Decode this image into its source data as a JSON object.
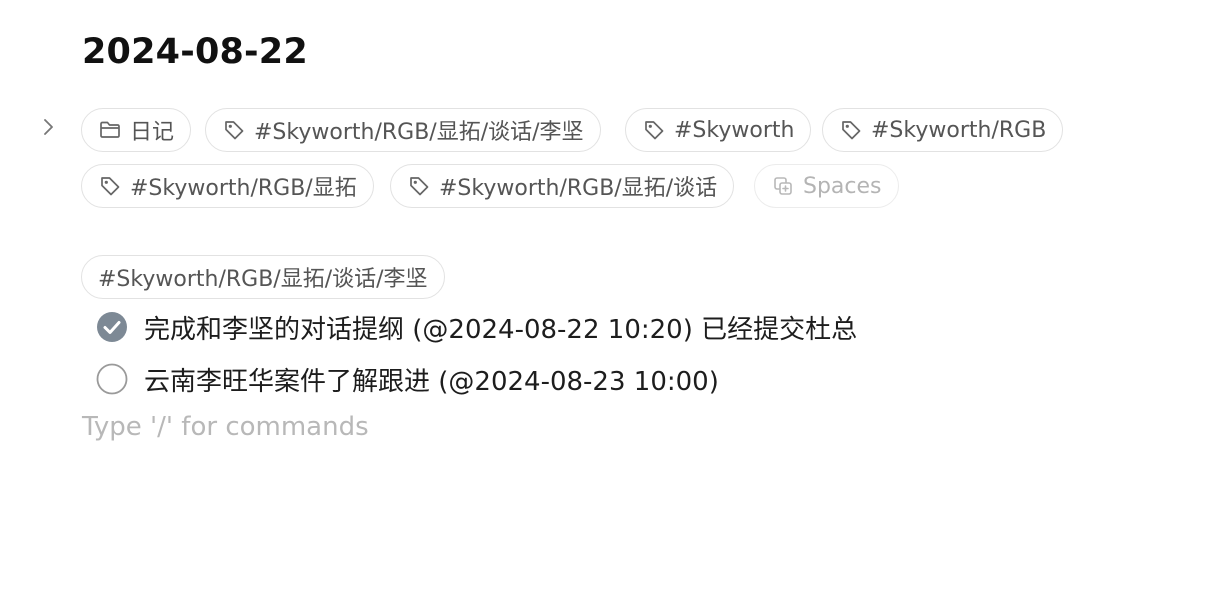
{
  "note": {
    "title": "2024-08-22"
  },
  "chips": [
    {
      "icon": "folder-icon",
      "label": "日记"
    },
    {
      "icon": "tag-icon",
      "label": "#Skyworth/RGB/显拓/谈话/李坚"
    },
    {
      "icon": "tag-icon",
      "label": "#Skyworth"
    },
    {
      "icon": "tag-icon",
      "label": "#Skyworth/RGB"
    },
    {
      "icon": "tag-icon",
      "label": "#Skyworth/RGB/显拓"
    },
    {
      "icon": "tag-icon",
      "label": "#Skyworth/RGB/显拓/谈话"
    },
    {
      "icon": "spaces-icon",
      "label": "Spaces"
    }
  ],
  "body": {
    "tag": "#Skyworth/RGB/显拓/谈话/李坚",
    "tasks": [
      {
        "checked": true,
        "text": "完成和李坚的对话提纲 (@2024-08-22 10:20) 已经提交杜总"
      },
      {
        "checked": false,
        "text": "云南李旺华案件了解跟进 (@2024-08-23 10:00)"
      }
    ],
    "placeholder": "Type '/' for commands"
  },
  "colors": {
    "check_fill": "#7d8995",
    "chip_border": "#e2e2e2",
    "placeholder": "#b8b8b8"
  }
}
